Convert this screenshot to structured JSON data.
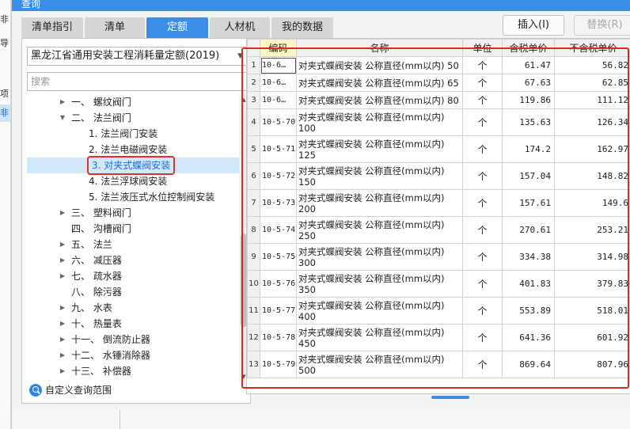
{
  "window": {
    "title": "查询"
  },
  "background": {
    "items": [
      "非力",
      "导出",
      "项工",
      "非力"
    ]
  },
  "tabs": [
    {
      "label": "清单指引"
    },
    {
      "label": "清单"
    },
    {
      "label": "定额"
    },
    {
      "label": "人材机"
    },
    {
      "label": "我的数据"
    }
  ],
  "toolbar": {
    "insert_label": "插入(I)",
    "replace_label": "替换(R)"
  },
  "left": {
    "quota_book": "黑龙江省通用安装工程消耗量定额(2019)",
    "search_placeholder": "搜索",
    "custom_range_label": "自定义查询范围"
  },
  "tree": [
    {
      "label": "一、 螺纹阀门",
      "level": 0,
      "caret": "▶"
    },
    {
      "label": "二、 法兰阀门",
      "level": 0,
      "caret": "▼"
    },
    {
      "label": "1. 法兰阀门安装",
      "level": 1,
      "caret": ""
    },
    {
      "label": "2. 法兰电磁阀安装",
      "level": 1,
      "caret": ""
    },
    {
      "label": "3. 对夹式蝶阀安装",
      "level": 1,
      "caret": "",
      "selected": true
    },
    {
      "label": "4. 法兰浮球阀安装",
      "level": 1,
      "caret": ""
    },
    {
      "label": "5. 法兰液压式水位控制阀安装",
      "level": 1,
      "caret": ""
    },
    {
      "label": "三、 塑料阀门",
      "level": 0,
      "caret": "▶"
    },
    {
      "label": "四、 沟槽阀门",
      "level": 0,
      "caret": ""
    },
    {
      "label": "五、 法兰",
      "level": 0,
      "caret": "▶"
    },
    {
      "label": "六、 减压器",
      "level": 0,
      "caret": "▶"
    },
    {
      "label": "七、 疏水器",
      "level": 0,
      "caret": "▶"
    },
    {
      "label": "八、 除污器",
      "level": 0,
      "caret": ""
    },
    {
      "label": "九、 水表",
      "level": 0,
      "caret": "▶"
    },
    {
      "label": "十、 热量表",
      "level": 0,
      "caret": "▶"
    },
    {
      "label": "十一、 倒流防止器",
      "level": 0,
      "caret": "▶"
    },
    {
      "label": "十二、 水锤消除器",
      "level": 0,
      "caret": "▶"
    },
    {
      "label": "十三、 补偿器",
      "level": 0,
      "caret": "▶"
    }
  ],
  "grid": {
    "headers": {
      "code": "编码",
      "name": "名称",
      "unit": "单位",
      "price_tax": "含税单价",
      "price_notax": "不含税单价"
    },
    "rows": [
      {
        "num": "1",
        "code": "10-6…",
        "name": "对夹式蝶阀安装 公称直径(mm以内) 50",
        "unit": "个",
        "price_tax": "61.47",
        "price_notax": "56.82"
      },
      {
        "num": "2",
        "code": "10-6…",
        "name": "对夹式蝶阀安装 公称直径(mm以内) 65",
        "unit": "个",
        "price_tax": "67.63",
        "price_notax": "62.85"
      },
      {
        "num": "3",
        "code": "10-6…",
        "name": "对夹式蝶阀安装 公称直径(mm以内) 80",
        "unit": "个",
        "price_tax": "119.86",
        "price_notax": "111.12"
      },
      {
        "num": "4",
        "code": "10-5-70",
        "name": "对夹式蝶阀安装 公称直径(mm以内) 100",
        "unit": "个",
        "price_tax": "135.63",
        "price_notax": "126.34"
      },
      {
        "num": "5",
        "code": "10-5-71",
        "name": "对夹式蝶阀安装 公称直径(mm以内) 125",
        "unit": "个",
        "price_tax": "174.2",
        "price_notax": "162.97"
      },
      {
        "num": "6",
        "code": "10-5-72",
        "name": "对夹式蝶阀安装 公称直径(mm以内) 150",
        "unit": "个",
        "price_tax": "157.04",
        "price_notax": "148.82"
      },
      {
        "num": "7",
        "code": "10-5-73",
        "name": "对夹式蝶阀安装 公称直径(mm以内) 200",
        "unit": "个",
        "price_tax": "157.61",
        "price_notax": "149.6"
      },
      {
        "num": "8",
        "code": "10-5-74",
        "name": "对夹式蝶阀安装 公称直径(mm以内) 250",
        "unit": "个",
        "price_tax": "270.61",
        "price_notax": "253.21"
      },
      {
        "num": "9",
        "code": "10-5-75",
        "name": "对夹式蝶阀安装 公称直径(mm以内) 300",
        "unit": "个",
        "price_tax": "334.38",
        "price_notax": "314.98"
      },
      {
        "num": "10",
        "code": "10-5-76",
        "name": "对夹式蝶阀安装 公称直径(mm以内) 350",
        "unit": "个",
        "price_tax": "401.83",
        "price_notax": "379.83"
      },
      {
        "num": "11",
        "code": "10-5-77",
        "name": "对夹式蝶阀安装 公称直径(mm以内) 400",
        "unit": "个",
        "price_tax": "553.89",
        "price_notax": "518.01"
      },
      {
        "num": "12",
        "code": "10-5-78",
        "name": "对夹式蝶阀安装 公称直径(mm以内) 450",
        "unit": "个",
        "price_tax": "641.36",
        "price_notax": "601.92"
      },
      {
        "num": "13",
        "code": "10-5-79",
        "name": "对夹式蝶阀安装 公称直径(mm以内) 500",
        "unit": "个",
        "price_tax": "869.64",
        "price_notax": "807.96"
      }
    ]
  },
  "colors": {
    "accent": "#3a8ee6",
    "highlight_frame": "#e02a20",
    "selected_bg": "#d3e7fb"
  }
}
